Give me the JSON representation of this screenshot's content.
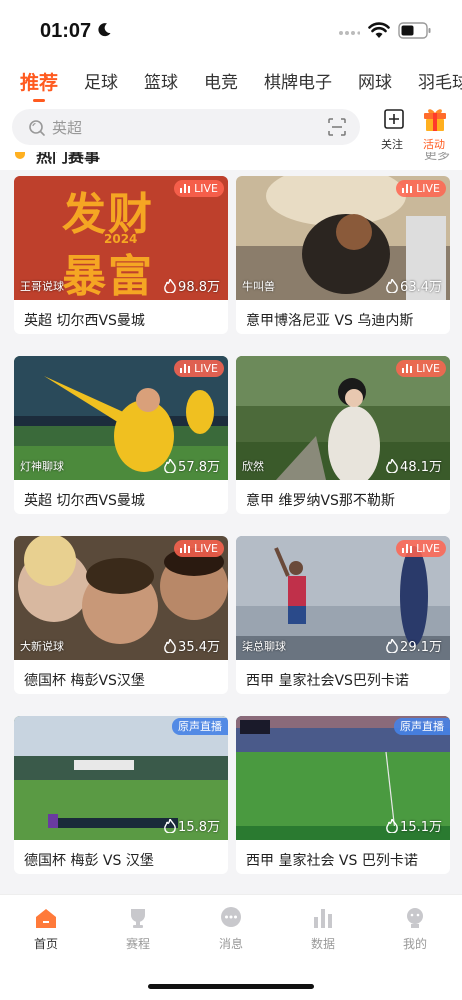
{
  "status": {
    "time": "01:07"
  },
  "nav": {
    "tabs": [
      "推荐",
      "足球",
      "篮球",
      "电竞",
      "棋牌电子",
      "网球",
      "羽毛球"
    ],
    "active_index": 0
  },
  "search": {
    "placeholder": "英超"
  },
  "header_actions": {
    "follow_label": "关注",
    "activity_label": "活动"
  },
  "section": {
    "title": "热门赛事",
    "more": "更多"
  },
  "cards": [
    {
      "badge": "LIVE",
      "badge_type": "live",
      "streamer": "王哥说球",
      "heat": "98.8万",
      "title": "英超 切尔西VS曼城",
      "overlay_text": [
        "发财",
        "2024",
        "暴富"
      ]
    },
    {
      "badge": "LIVE",
      "badge_type": "live",
      "streamer": "牛叫兽",
      "heat": "63.4万",
      "title": "意甲博洛尼亚 VS 乌迪内斯"
    },
    {
      "badge": "LIVE",
      "badge_type": "live",
      "streamer": "灯神聊球",
      "heat": "57.8万",
      "title": "英超 切尔西VS曼城"
    },
    {
      "badge": "LIVE",
      "badge_type": "live",
      "streamer": "欣然",
      "heat": "48.1万",
      "title": "意甲 维罗纳VS那不勒斯"
    },
    {
      "badge": "LIVE",
      "badge_type": "live",
      "streamer": "大新说球",
      "heat": "35.4万",
      "title": "德国杯 梅彭VS汉堡"
    },
    {
      "badge": "LIVE",
      "badge_type": "live",
      "streamer": "柒总聊球",
      "heat": "29.1万",
      "title": "西甲 皇家社会VS巴列卡诺"
    },
    {
      "badge": "原声直播",
      "badge_type": "orig",
      "streamer": "",
      "heat": "15.8万",
      "title": "德国杯 梅彭 VS 汉堡"
    },
    {
      "badge": "原声直播",
      "badge_type": "orig",
      "streamer": "",
      "heat": "15.1万",
      "title": "西甲 皇家社会 VS 巴列卡诺"
    }
  ],
  "tabbar": {
    "items": [
      "首页",
      "赛程",
      "消息",
      "数据",
      "我的"
    ],
    "active_index": 0
  },
  "colors": {
    "accent": "#ff5a1f",
    "live_badge": "#ff6450",
    "orig_badge": "#4682e6"
  }
}
